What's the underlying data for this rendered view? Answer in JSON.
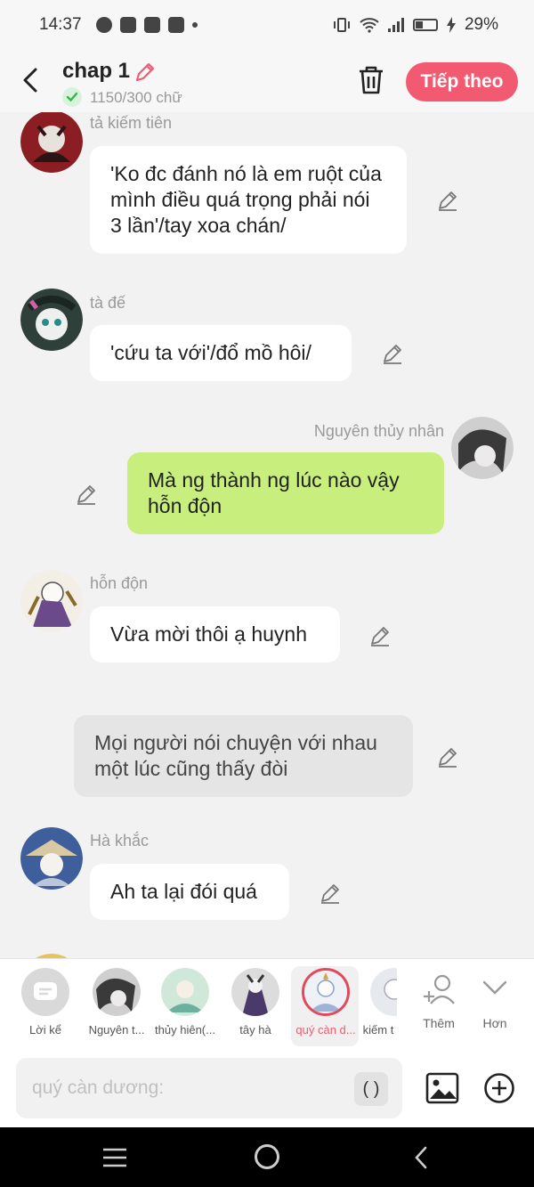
{
  "status_bar": {
    "time": "14:37",
    "battery": "29%",
    "app_icons": [
      "messenger-icon",
      "facebook-icon",
      "capcut-icon",
      "youtube-icon"
    ]
  },
  "header": {
    "title": "chap 1",
    "word_count": "1150/300 chữ",
    "next_label": "Tiếp theo"
  },
  "colors": {
    "accent": "#f25a71",
    "bubble_self": "#c8ef7d",
    "bubble_other": "#ffffff",
    "bubble_narration": "#e5e5e5"
  },
  "messages": [
    {
      "sender": "tả kiếm tiên",
      "text": "'Ko đc đánh nó là em ruột của mình điều quá trọng phải nói 3 lần'/tay xoa chán/",
      "side": "left"
    },
    {
      "sender": "tà đế",
      "text": "'cứu ta với'/đổ mồ hôi/",
      "side": "left"
    },
    {
      "sender": "Nguyên thủy nhân",
      "text": "Mà ng thành ng lúc nào vậy hỗn độn",
      "side": "right"
    },
    {
      "sender": "hỗn độn",
      "text": "Vừa mời thôi ạ huynh",
      "side": "left"
    },
    {
      "sender": "",
      "text": "Mọi người nói chuyện với nhau một lúc cũng thấy đòi",
      "side": "narration"
    },
    {
      "sender": "Hà khắc",
      "text": "Ah ta lại đói quá",
      "side": "left"
    }
  ],
  "character_bar": {
    "narrator_label": "Lời kể",
    "characters": [
      {
        "label": "Nguyên t..."
      },
      {
        "label": "thủy hiên(..."
      },
      {
        "label": "tây hà"
      },
      {
        "label": "quý càn d..."
      },
      {
        "label": "kiếm t"
      }
    ],
    "add_label": "Thêm",
    "more_label": "Hơn"
  },
  "input": {
    "placeholder": "quý càn dương:",
    "paren_label": "( )"
  }
}
